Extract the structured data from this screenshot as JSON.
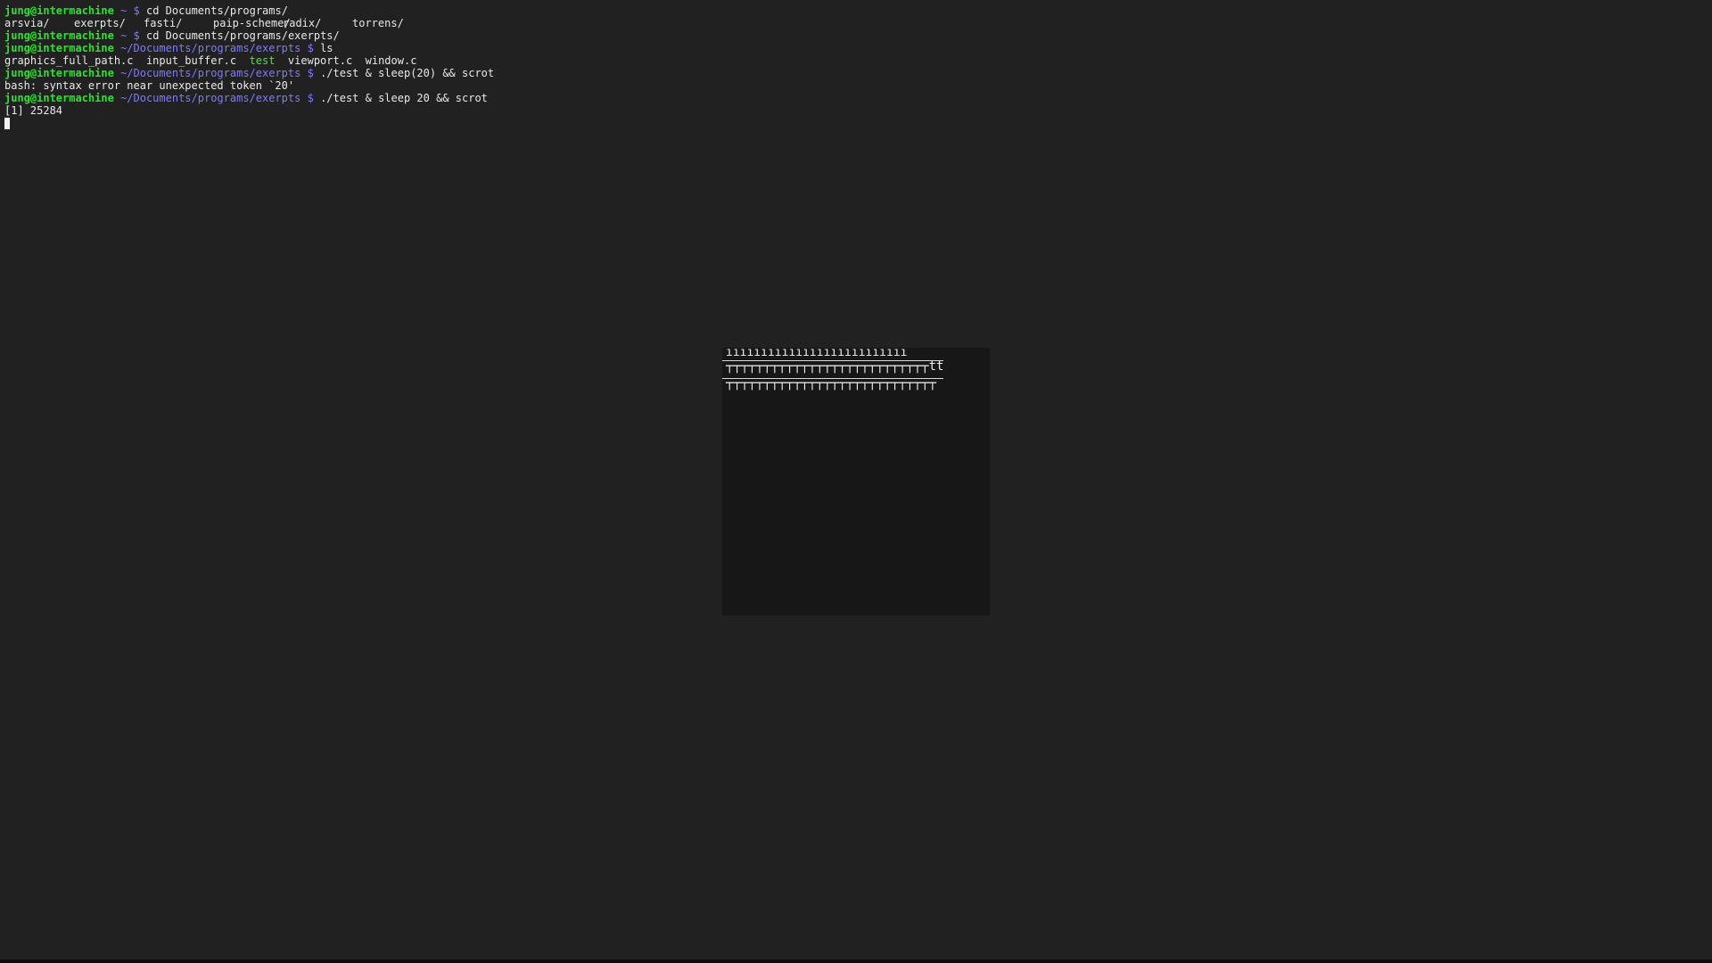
{
  "prompt": {
    "user": "jung@intermachine",
    "dollar": "$"
  },
  "terminal": {
    "lines": [
      {
        "path": "~",
        "cmd": "cd Documents/programs/"
      },
      {
        "path": "~",
        "cmd": "cd Documents/programs/exerpts/"
      },
      {
        "path": "~/Documents/programs/exerpts",
        "cmd": "ls"
      },
      {
        "path": "~/Documents/programs/exerpts",
        "cmd": "./test & sleep(20) && scrot"
      },
      {
        "path": "~/Documents/programs/exerpts",
        "cmd": "./test & sleep 20 && scrot"
      }
    ],
    "ls_dirs": [
      "arsvia/",
      "exerpts/",
      "fasti/",
      "paip-scheme/",
      "radix/",
      "torrens/"
    ],
    "ls_files": {
      "graphics": "graphics_full_path.c",
      "input": "input_buffer.c",
      "test": "test",
      "viewport": "viewport.c",
      "window": "window.c"
    },
    "error": "bash: syntax error near unexpected token `20'",
    "job": "[1] 25284"
  },
  "app_window": {
    "row1": "ıııııııııııııııııııııııııı",
    "row2": "┬┬┬┬┬┬┬┬┬┬┬┬┬┬┬┬┬┬┬┬┬┬┬┬┬┬┬tt",
    "row3": "┬┬┬┬┬┬┬┬┬┬┬┬┬┬┬┬┬┬┬┬┬┬┬┬┬┬┬┬"
  },
  "colors": {
    "background": "#212121",
    "user": "#29e329",
    "path": "#7a7aff",
    "text": "#e8e8e8"
  }
}
